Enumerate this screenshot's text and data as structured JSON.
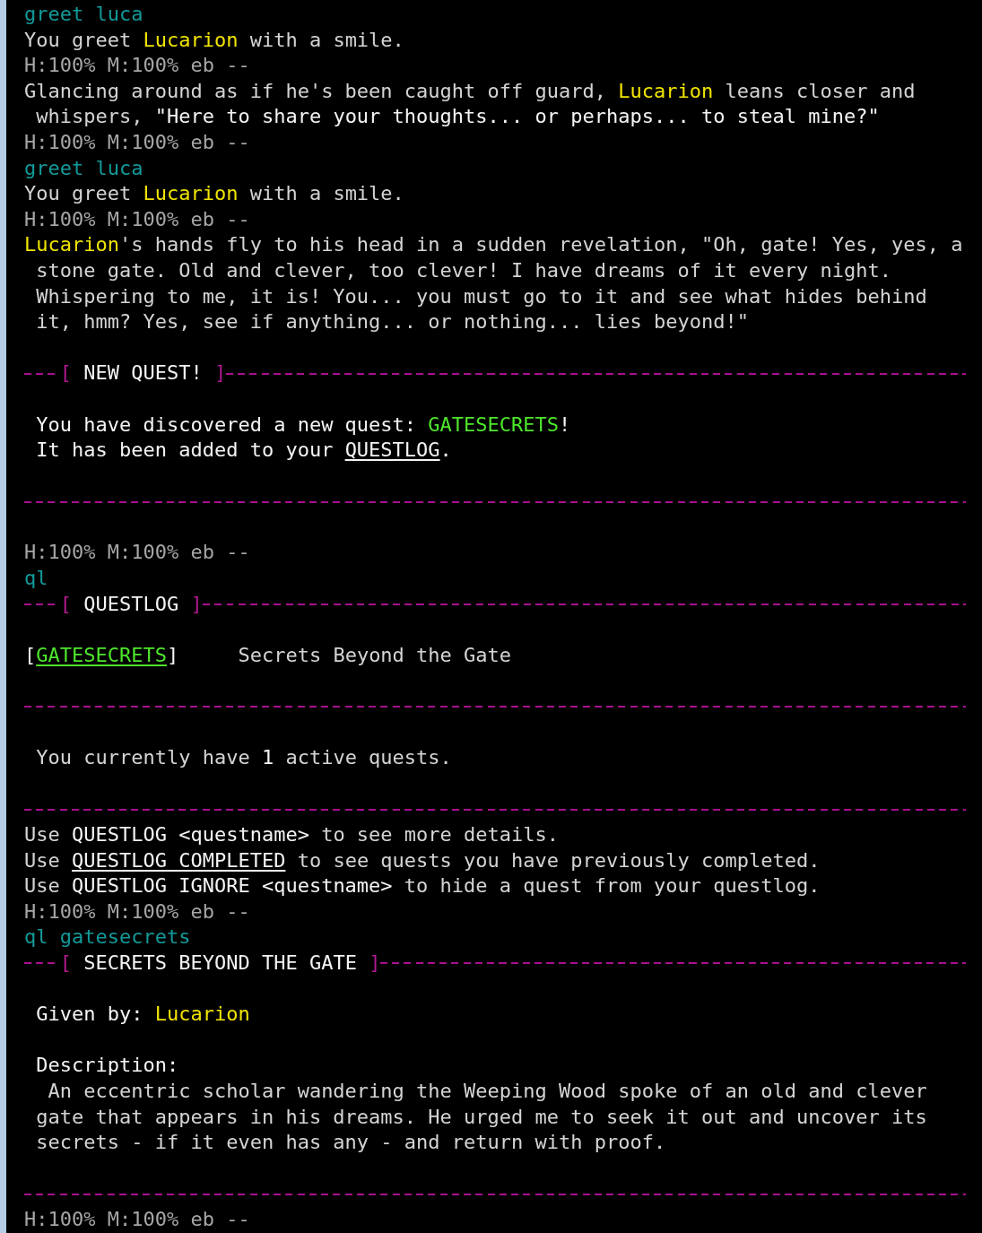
{
  "lines": [
    {
      "kind": "command",
      "segments": [
        {
          "kind": "cmd",
          "text": "greet luca"
        }
      ]
    },
    {
      "kind": "text",
      "segments": [
        {
          "kind": "text",
          "text": "You greet "
        },
        {
          "kind": "name",
          "text": "Lucarion"
        },
        {
          "kind": "text",
          "text": " with a smile."
        }
      ]
    },
    {
      "kind": "prompt",
      "segments": [
        {
          "kind": "prompt",
          "text": "H:100% M:100% eb --"
        }
      ]
    },
    {
      "kind": "text",
      "segments": [
        {
          "kind": "text",
          "text": "Glancing around as if he's been caught off guard, "
        },
        {
          "kind": "name",
          "text": "Lucarion"
        },
        {
          "kind": "text",
          "text": " leans closer and"
        }
      ]
    },
    {
      "kind": "text",
      "segments": [
        {
          "kind": "text",
          "text": " whispers, "
        },
        {
          "kind": "bright",
          "text": "\"Here to share your thoughts... or perhaps... to steal mine?\""
        }
      ]
    },
    {
      "kind": "prompt",
      "segments": [
        {
          "kind": "prompt",
          "text": "H:100% M:100% eb --"
        }
      ]
    },
    {
      "kind": "command",
      "segments": [
        {
          "kind": "cmd",
          "text": "greet luca"
        }
      ]
    },
    {
      "kind": "text",
      "segments": [
        {
          "kind": "text",
          "text": "You greet "
        },
        {
          "kind": "name",
          "text": "Lucarion"
        },
        {
          "kind": "text",
          "text": " with a smile."
        }
      ]
    },
    {
      "kind": "prompt",
      "segments": [
        {
          "kind": "prompt",
          "text": "H:100% M:100% eb --"
        }
      ]
    },
    {
      "kind": "text",
      "segments": [
        {
          "kind": "name",
          "text": "Lucarion"
        },
        {
          "kind": "text",
          "text": "'s hands fly to his head in a sudden revelation, \"Oh, gate! Yes, yes, a"
        }
      ]
    },
    {
      "kind": "text",
      "segments": [
        {
          "kind": "text",
          "text": " stone gate. Old and clever, too clever! I have dreams of it every night."
        }
      ]
    },
    {
      "kind": "text",
      "segments": [
        {
          "kind": "text",
          "text": " Whispering to me, it is! You... you must go to it and see what hides behind"
        }
      ]
    },
    {
      "kind": "text",
      "segments": [
        {
          "kind": "text",
          "text": " it, hmm? Yes, see if anything... or nothing... lies beyond!\""
        }
      ]
    },
    {
      "kind": "blank"
    },
    {
      "kind": "rule",
      "segments": [
        {
          "kind": "bracket",
          "text": "["
        },
        {
          "kind": "bright",
          "text": " NEW QUEST! "
        },
        {
          "kind": "bracket",
          "text": "]"
        }
      ]
    },
    {
      "kind": "blank"
    },
    {
      "kind": "text",
      "segments": [
        {
          "kind": "bright",
          "text": " You have discovered a new quest: "
        },
        {
          "kind": "quest",
          "text": "GATESECRETS"
        },
        {
          "kind": "bright",
          "text": "!"
        }
      ]
    },
    {
      "kind": "text",
      "segments": [
        {
          "kind": "bright",
          "text": " It has been added to your "
        },
        {
          "kind": "link",
          "text": "QUESTLOG"
        },
        {
          "kind": "bright",
          "text": "."
        }
      ]
    },
    {
      "kind": "blank"
    },
    {
      "kind": "rule"
    },
    {
      "kind": "blank"
    },
    {
      "kind": "prompt",
      "segments": [
        {
          "kind": "prompt",
          "text": "H:100% M:100% eb --"
        }
      ]
    },
    {
      "kind": "command",
      "segments": [
        {
          "kind": "cmd",
          "text": "ql"
        }
      ]
    },
    {
      "kind": "rule",
      "segments": [
        {
          "kind": "bracket",
          "text": "["
        },
        {
          "kind": "bright",
          "text": " QUESTLOG "
        },
        {
          "kind": "bracket",
          "text": "]"
        }
      ]
    },
    {
      "kind": "blank"
    },
    {
      "kind": "text",
      "segments": [
        {
          "kind": "bright",
          "text": "["
        },
        {
          "kind": "quest_link",
          "text": "GATESECRETS"
        },
        {
          "kind": "bright",
          "text": "]"
        },
        {
          "kind": "text",
          "text": "     Secrets Beyond the Gate"
        }
      ]
    },
    {
      "kind": "blank"
    },
    {
      "kind": "rule"
    },
    {
      "kind": "blank"
    },
    {
      "kind": "text",
      "segments": [
        {
          "kind": "text",
          "text": " You currently have "
        },
        {
          "kind": "bright",
          "text": "1"
        },
        {
          "kind": "text",
          "text": " active quests."
        }
      ]
    },
    {
      "kind": "blank"
    },
    {
      "kind": "rule"
    },
    {
      "kind": "text",
      "segments": [
        {
          "kind": "text",
          "text": "Use "
        },
        {
          "kind": "bright",
          "text": "QUESTLOG <questname>"
        },
        {
          "kind": "text",
          "text": " to see more details."
        }
      ]
    },
    {
      "kind": "text",
      "segments": [
        {
          "kind": "text",
          "text": "Use "
        },
        {
          "kind": "link",
          "text": "QUESTLOG COMPLETED"
        },
        {
          "kind": "text",
          "text": " to see quests you have previously completed."
        }
      ]
    },
    {
      "kind": "text",
      "segments": [
        {
          "kind": "text",
          "text": "Use "
        },
        {
          "kind": "bright",
          "text": "QUESTLOG IGNORE <questname>"
        },
        {
          "kind": "text",
          "text": " to hide a quest from your questlog."
        }
      ]
    },
    {
      "kind": "prompt",
      "segments": [
        {
          "kind": "prompt",
          "text": "H:100% M:100% eb --"
        }
      ]
    },
    {
      "kind": "command",
      "segments": [
        {
          "kind": "cmd",
          "text": "ql gatesecrets"
        }
      ]
    },
    {
      "kind": "rule",
      "segments": [
        {
          "kind": "bracket",
          "text": "["
        },
        {
          "kind": "bright",
          "text": " SECRETS BEYOND THE GATE "
        },
        {
          "kind": "bracket",
          "text": "]"
        }
      ]
    },
    {
      "kind": "blank"
    },
    {
      "kind": "text",
      "segments": [
        {
          "kind": "bright",
          "text": " Given by: "
        },
        {
          "kind": "name",
          "text": "Lucarion"
        }
      ]
    },
    {
      "kind": "blank"
    },
    {
      "kind": "text",
      "segments": [
        {
          "kind": "bright",
          "text": " Description:"
        }
      ]
    },
    {
      "kind": "text",
      "segments": [
        {
          "kind": "text",
          "text": "  An eccentric scholar wandering the Weeping Wood spoke of an old and clever"
        }
      ]
    },
    {
      "kind": "text",
      "segments": [
        {
          "kind": "text",
          "text": " gate that appears in his dreams. He urged me to seek it out and uncover its"
        }
      ]
    },
    {
      "kind": "text",
      "segments": [
        {
          "kind": "text",
          "text": " secrets - if it even has any - and return with proof."
        }
      ]
    },
    {
      "kind": "blank"
    },
    {
      "kind": "rule"
    },
    {
      "kind": "prompt",
      "segments": [
        {
          "kind": "prompt",
          "text": "H:100% M:100% eb --"
        }
      ]
    }
  ]
}
